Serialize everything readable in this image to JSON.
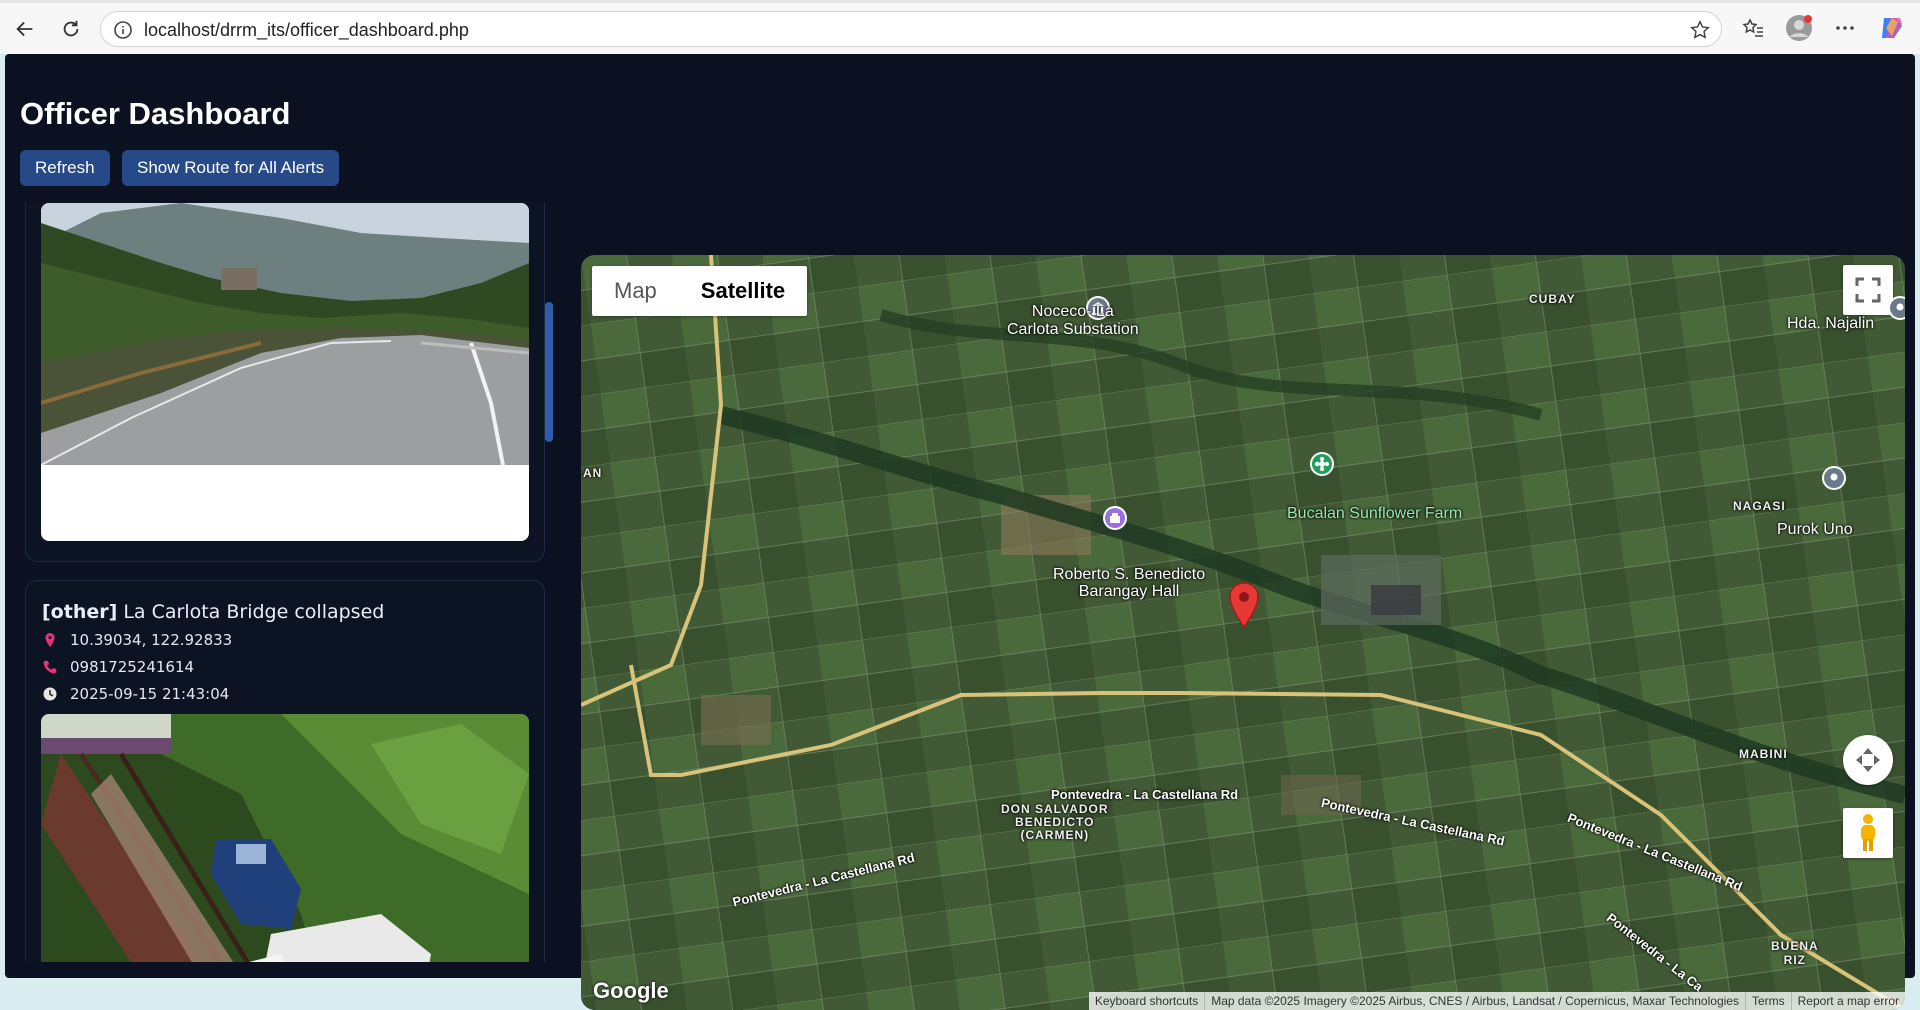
{
  "browser": {
    "url": "localhost/drrm_its/officer_dashboard.php"
  },
  "page": {
    "title": "Officer Dashboard",
    "buttons": {
      "refresh": "Refresh",
      "show_route": "Show Route for All Alerts"
    }
  },
  "alerts": [
    {
      "type": "",
      "title": "",
      "image": "road-photo"
    },
    {
      "type": "[other]",
      "title": "La Carlota Bridge collapsed",
      "coords": "10.39034, 122.92833",
      "phone": "0981725241614",
      "timestamp": "2025-09-15 21:43:04",
      "image": "collapsed-bridge-photo"
    }
  ],
  "map": {
    "toggle": {
      "map": "Map",
      "satellite": "Satellite",
      "selected": "Satellite"
    },
    "labels": {
      "substation_line1": "Noceco- La",
      "substation_line2": "Carlota Substation",
      "cubay": "CUBAY",
      "hda": "Hda. Najalin",
      "an": "AN",
      "farm": "Bucalan Sunflower Farm",
      "nagasi": "NAGASI",
      "purok": "Purok Uno",
      "hall_line1": "Roberto S. Benedicto",
      "hall_line2": "Barangay Hall",
      "mabini": "MABINI",
      "road1": "Pontevedra - La Castellana Rd",
      "road2": "Pontevedra - La Castellana Rd",
      "road3": "Pontevedra - La Castellana Rd",
      "road4": "Pontevedra - La Castellana Rd",
      "road5": "Pontevedra - La Ca",
      "dsb1": "DON SALVADOR",
      "dsb2": "BENEDICTO",
      "dsb3": "(CARMEN)",
      "buena1": "BUENA",
      "buena2": "RIZ"
    },
    "logo": "Google",
    "attribution": {
      "shortcuts": "Keyboard shortcuts",
      "data": "Map data ©2025 Imagery ©2025 Airbus, CNES / Airbus, Landsat / Copernicus, Maxar Technologies",
      "terms": "Terms",
      "report": "Report a map error"
    }
  },
  "colors": {
    "page_bg": "#0b1120",
    "button_bg": "#254a87",
    "marker_red": "#e53935",
    "accent_pink": "#e8337a"
  }
}
